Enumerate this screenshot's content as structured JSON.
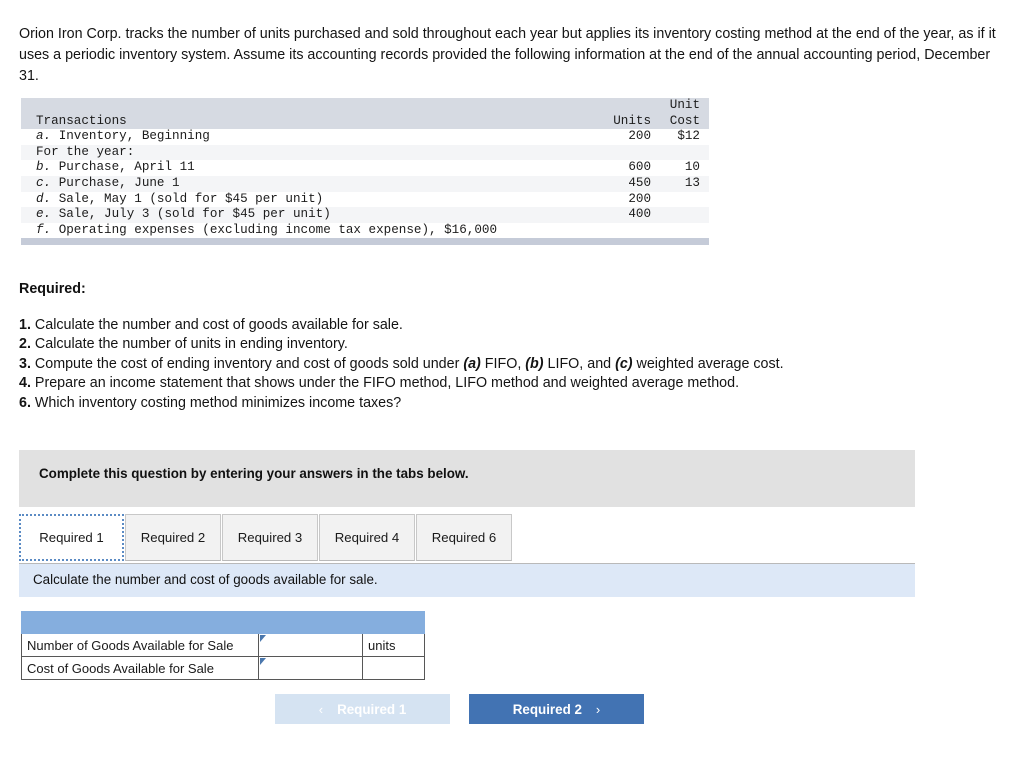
{
  "intro": {
    "paragraph": "Orion Iron Corp. tracks the number of units purchased and sold throughout each year but applies its inventory costing method at the end of the year, as if it uses a periodic inventory system. Assume its accounting records provided the following information at the end of the annual accounting period, December 31."
  },
  "txn_table": {
    "headers": {
      "transactions": "Transactions",
      "units": "Units",
      "unit_cost_line1": "Unit",
      "unit_cost_line2": "Cost"
    },
    "rows": [
      {
        "letter": "a.",
        "label": "Inventory, Beginning",
        "units": "200",
        "cost": "$12"
      },
      {
        "letter": "",
        "label": "For the year:",
        "units": "",
        "cost": ""
      },
      {
        "letter": "b.",
        "label": "Purchase, April 11",
        "units": "600",
        "cost": "10"
      },
      {
        "letter": "c.",
        "label": "Purchase, June 1",
        "units": "450",
        "cost": "13"
      },
      {
        "letter": "d.",
        "label": "Sale, May 1 (sold for $45 per unit)",
        "units": "200",
        "cost": ""
      },
      {
        "letter": "e.",
        "label": "Sale, July 3 (sold for $45 per unit)",
        "units": "400",
        "cost": ""
      },
      {
        "letter": "f.",
        "label": "Operating expenses (excluding income tax expense), $16,000",
        "units": "",
        "cost": ""
      }
    ]
  },
  "required": {
    "heading": "Required:",
    "items": [
      {
        "num": "1.",
        "text": "Calculate the number and cost of goods available for sale."
      },
      {
        "num": "2.",
        "text": "Calculate the number of units in ending inventory."
      },
      {
        "num": "3.",
        "text_a": "Compute the cost of ending inventory and cost of goods sold under ",
        "em_a": "(a)",
        "text_b": " FIFO, ",
        "em_b": "(b)",
        "text_c": " LIFO, and ",
        "em_c": "(c)",
        "text_d": " weighted average cost."
      },
      {
        "num": "4.",
        "text": "Prepare an income statement that shows under the FIFO method, LIFO method and weighted average method."
      },
      {
        "num": "6.",
        "text": "Which inventory costing method minimizes income taxes?"
      }
    ]
  },
  "instruction_bar": {
    "text": "Complete this question by entering your answers in the tabs below."
  },
  "tabs": [
    {
      "label": "Required 1",
      "active": true
    },
    {
      "label": "Required 2",
      "active": false
    },
    {
      "label": "Required 3",
      "active": false
    },
    {
      "label": "Required 4",
      "active": false
    },
    {
      "label": "Required 6",
      "active": false
    }
  ],
  "sub_instruction": {
    "text": "Calculate the number and cost of goods available for sale."
  },
  "answer_table": {
    "header_label": "",
    "rows": [
      {
        "label": "Number of Goods Available for Sale",
        "value": "",
        "unit": "units"
      },
      {
        "label": "Cost of Goods Available for Sale",
        "value": "",
        "unit": ""
      }
    ]
  },
  "nav": {
    "prev_label": "Required 1",
    "prev_chevron": "‹",
    "next_label": "Required 2",
    "next_chevron": "›"
  },
  "colors": {
    "table_header_gray": "#d6dae2",
    "table_footbar": "#c5cbd8",
    "instruction_gray": "#e1e1e1",
    "sub_instruction_blue": "#dde8f7",
    "answer_header_blue": "#85aede",
    "input_border_blue": "#4a77ad",
    "nav_active_blue": "#4273b3",
    "nav_disabled_blue": "#d5e3f2",
    "tab_focus_blue": "#5b8bc4"
  }
}
